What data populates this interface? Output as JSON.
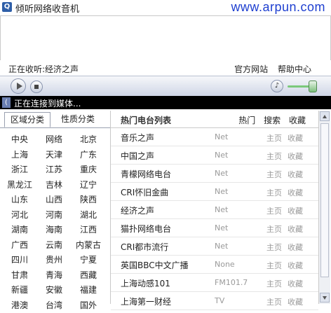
{
  "window": {
    "title": "倾听网络收音机",
    "watermark": "www.arpun.com"
  },
  "info": {
    "now_playing": "正在收听:经济之声",
    "links": [
      "官方网站",
      "帮助中心"
    ]
  },
  "status": {
    "text": "正在连接到媒体..."
  },
  "left_tabs": {
    "active": "区域分类",
    "inactive": "性质分类"
  },
  "regions": [
    "中央",
    "网络",
    "北京",
    "上海",
    "天津",
    "广东",
    "浙江",
    "江苏",
    "重庆",
    "黑龙江",
    "吉林",
    "辽宁",
    "山东",
    "山西",
    "陕西",
    "河北",
    "河南",
    "湖北",
    "湖南",
    "海南",
    "江西",
    "广西",
    "云南",
    "内蒙古",
    "四川",
    "贵州",
    "宁夏",
    "甘肃",
    "青海",
    "西藏",
    "新疆",
    "安徽",
    "福建",
    "港澳",
    "台湾",
    "国外"
  ],
  "station_list": {
    "title": "热门电台列表",
    "links": [
      "热门",
      "搜索",
      "收藏"
    ],
    "home_label": "主页",
    "fav_label": "收藏",
    "rows": [
      {
        "name": "音乐之声",
        "freq": "Net"
      },
      {
        "name": "中国之声",
        "freq": "Net"
      },
      {
        "name": "青檬网络电台",
        "freq": "Net"
      },
      {
        "name": "CRI怀旧金曲",
        "freq": "Net"
      },
      {
        "name": "经济之声",
        "freq": "Net"
      },
      {
        "name": "猫扑网络电台",
        "freq": "Net"
      },
      {
        "name": "CRI都市流行",
        "freq": "Net"
      },
      {
        "name": "英国BBC中文广播",
        "freq": "None"
      },
      {
        "name": "上海动感101",
        "freq": "FM101.7"
      },
      {
        "name": "上海第一财经",
        "freq": "TV"
      }
    ]
  },
  "colors": {
    "accent": "#2f5fa8",
    "watermark": "#1e3fd0",
    "status_bg": "#000000",
    "volume": "#7bc97b"
  }
}
